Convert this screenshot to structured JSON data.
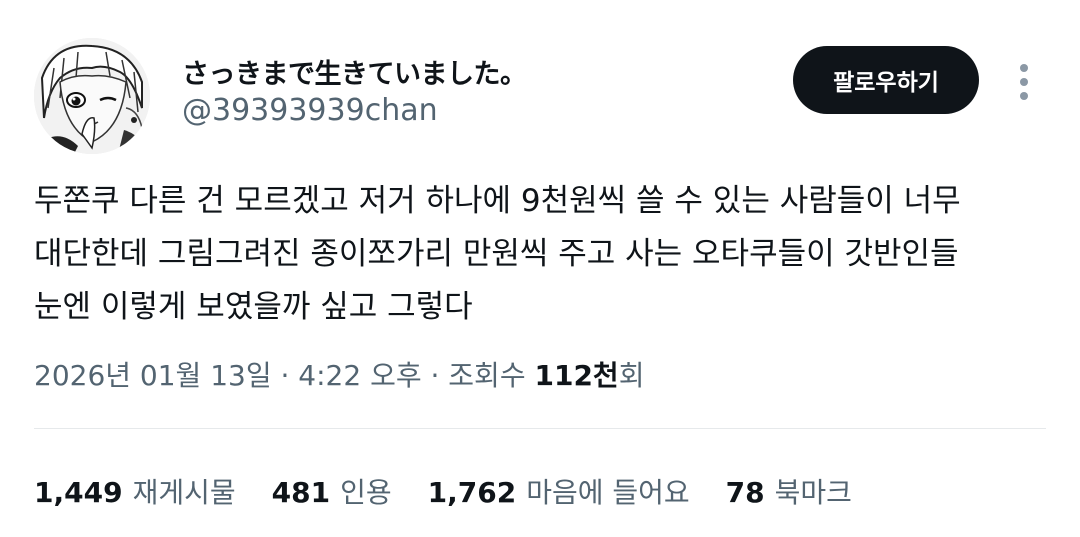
{
  "author": {
    "display_name": "さっきまで生きていました。",
    "handle": "@39393939chan"
  },
  "follow_label": "팔로우하기",
  "tweet": {
    "lines": [
      "두쫀쿠 다른 건 모르겠고 저거 하나에 9천원씩 쓸 수 있는 사람들이 너무",
      "대단한데 그림그려진 종이쪼가리 만원씩 주고 사는 오타쿠들이 갓반인들",
      "눈엔 이렇게 보였을까 싶고 그렇다"
    ]
  },
  "meta": {
    "timestamp": "2026년 01월 13일 · 4:22 오후 · 조회수 ",
    "views_count": "112천",
    "views_suffix": "회"
  },
  "stats": {
    "reposts": {
      "count": "1,449",
      "label": "재게시물"
    },
    "quotes": {
      "count": "481",
      "label": "인용"
    },
    "likes": {
      "count": "1,762",
      "label": "마음에 들어요"
    },
    "bookmarks": {
      "count": "78",
      "label": "북마크"
    }
  },
  "icons": {
    "avatar": "anime-girl-sketch-avatar",
    "more": "vertical-ellipsis-icon"
  }
}
